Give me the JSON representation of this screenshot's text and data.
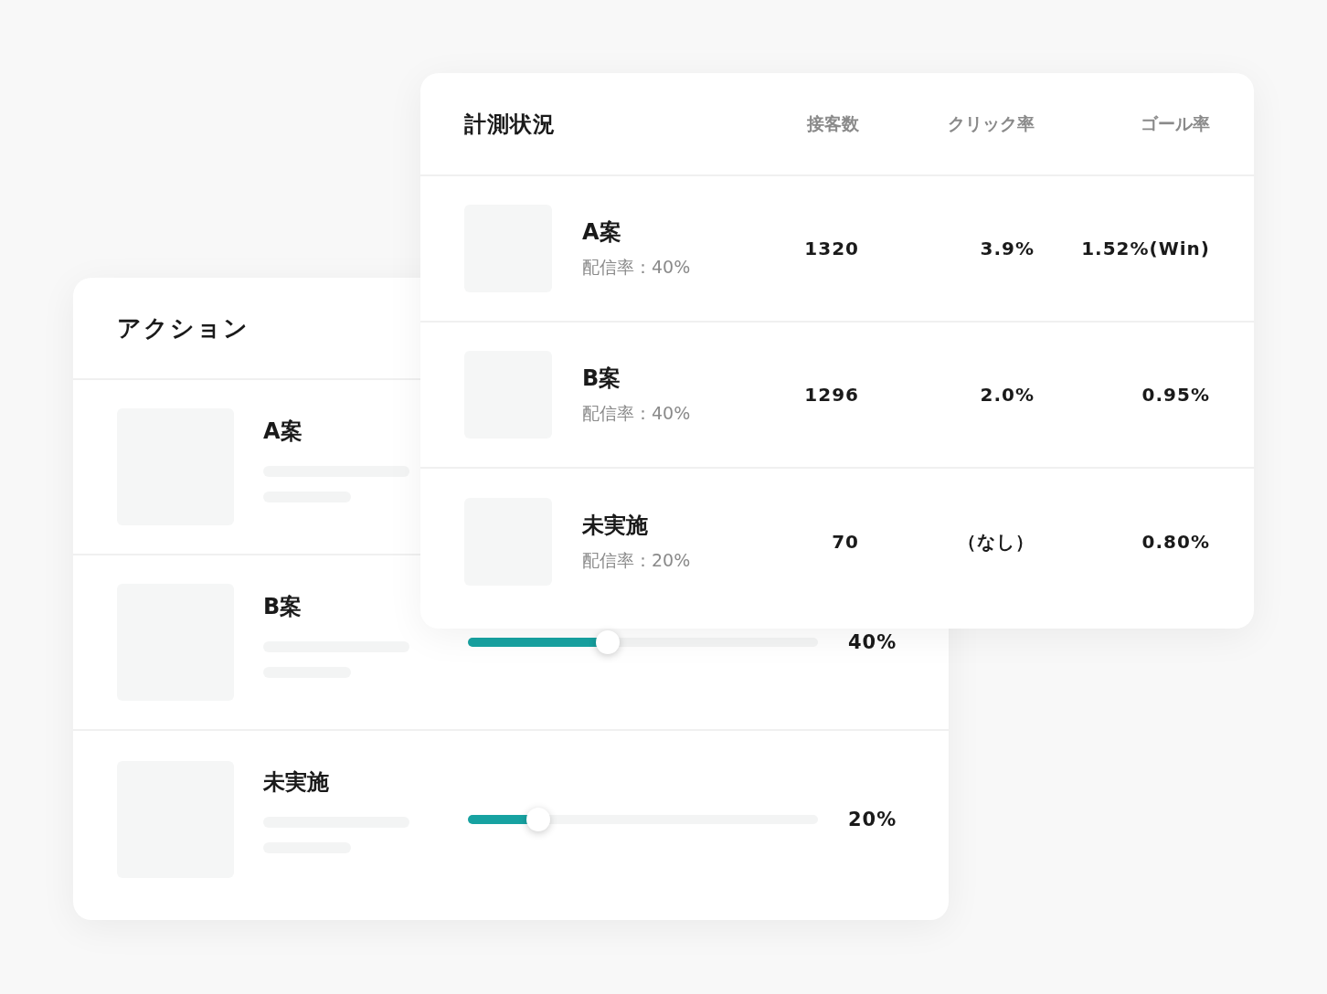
{
  "actions_panel": {
    "title": "アクション",
    "rows": [
      {
        "name": "A案"
      },
      {
        "name": "B案",
        "level": 0.4,
        "reading": "40%"
      },
      {
        "name": "未実施",
        "level": 0.2,
        "reading": "20%"
      }
    ]
  },
  "measurement_panel": {
    "title": "計測状況",
    "columns": [
      "接客数",
      "クリック率",
      "ゴール率"
    ],
    "rows": [
      {
        "name": "A案",
        "rate": "配信率：40%",
        "visitors": "1320",
        "click_rate": "3.9%",
        "goal_rate": "1.52%(Win)"
      },
      {
        "name": "B案",
        "rate": "配信率：40%",
        "visitors": "1296",
        "click_rate": "2.0%",
        "goal_rate": "0.95%"
      },
      {
        "name": "未実施",
        "rate": "配信率：20%",
        "visitors": "70",
        "click_rate": "（なし）",
        "goal_rate": "0.80%"
      }
    ]
  }
}
